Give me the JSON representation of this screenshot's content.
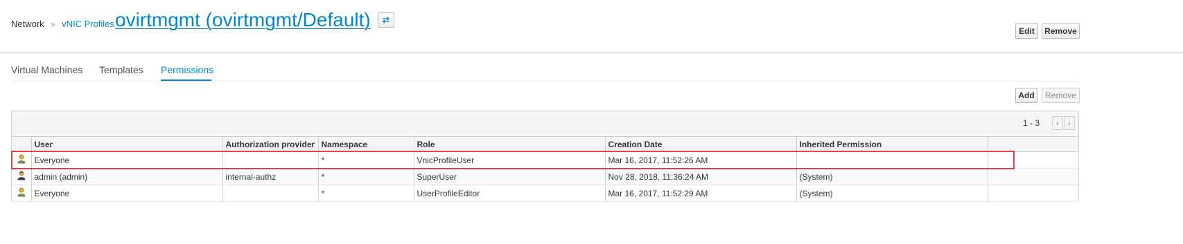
{
  "breadcrumb": {
    "root": "Network",
    "parent": "vNIC Profiles",
    "sep": "»"
  },
  "header": {
    "title": "ovirtmgmt (ovirtmgmt/Default)",
    "edit_label": "Edit",
    "remove_label": "Remove"
  },
  "tabs": [
    {
      "label": "Virtual Machines",
      "active": false
    },
    {
      "label": "Templates",
      "active": false
    },
    {
      "label": "Permissions",
      "active": true
    }
  ],
  "permissions_toolbar": {
    "add_label": "Add",
    "remove_label": "Remove"
  },
  "pager": {
    "range": "1 - 3",
    "prev": "‹",
    "next": "›"
  },
  "table": {
    "columns": [
      "User",
      "Authorization provider",
      "Namespace",
      "Role",
      "Creation Date",
      "Inherited Permission"
    ],
    "rows": [
      {
        "icon": "group-user-icon",
        "user": "Everyone",
        "provider": "",
        "namespace": "*",
        "role": "VnicProfileUser",
        "created": "Mar 16, 2017, 11:52:26 AM",
        "inherited": ""
      },
      {
        "icon": "admin-user-icon",
        "user": "admin (admin)",
        "provider": "internal-authz",
        "namespace": "*",
        "role": "SuperUser",
        "created": "Nov 28, 2018, 11:36:24 AM",
        "inherited": "(System)"
      },
      {
        "icon": "group-user-icon",
        "user": "Everyone",
        "provider": "",
        "namespace": "*",
        "role": "UserProfileEditor",
        "created": "Mar 16, 2017, 11:52:29 AM",
        "inherited": "(System)"
      }
    ]
  },
  "colors": {
    "accent": "#0088ce",
    "highlight": "#e23f3f"
  }
}
